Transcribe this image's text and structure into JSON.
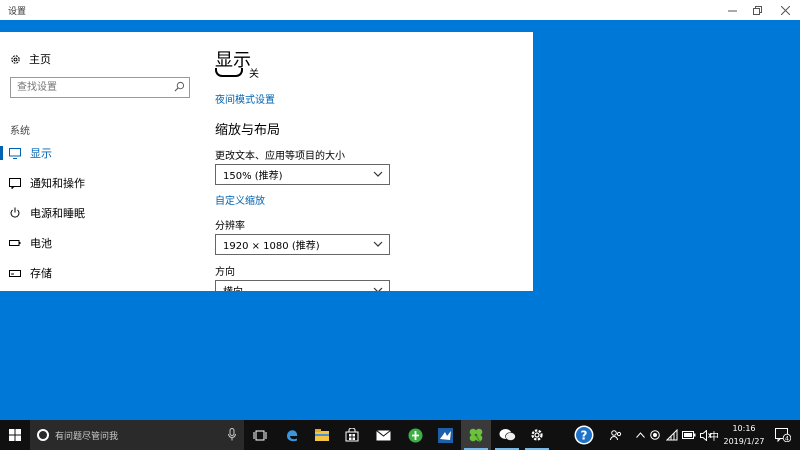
{
  "window": {
    "title": "设置"
  },
  "sidebar": {
    "home_label": "主页",
    "search_placeholder": "查找设置",
    "section_label": "系统",
    "items": [
      {
        "label": "显示",
        "icon": "monitor-icon",
        "active": true
      },
      {
        "label": "通知和操作",
        "icon": "message-icon",
        "active": false
      },
      {
        "label": "电源和睡眠",
        "icon": "power-icon",
        "active": false
      },
      {
        "label": "电池",
        "icon": "battery-icon",
        "active": false
      },
      {
        "label": "存储",
        "icon": "storage-icon",
        "active": false
      }
    ]
  },
  "content": {
    "page_title": "显示",
    "night_light_state": "关",
    "night_light_link": "夜间模式设置",
    "scale_section_title": "缩放与布局",
    "scale_label": "更改文本、应用等项目的大小",
    "scale_value": "150% (推荐)",
    "custom_scale_link": "自定义缩放",
    "resolution_label": "分辨率",
    "resolution_value": "1920 × 1080 (推荐)",
    "orientation_label": "方向",
    "orientation_value": "横向"
  },
  "taskbar": {
    "search_placeholder": "有问题尽管问我",
    "apps": [
      "task-view-icon",
      "edge-icon",
      "file-explorer-icon",
      "store-icon",
      "mail-icon",
      "green-app-icon",
      "bird-app-icon",
      "clover-app-icon",
      "wechat-icon",
      "settings-gear-icon",
      "help-icon"
    ],
    "tray": {
      "ime": "中",
      "time": "10:16",
      "date": "2019/1/27",
      "notification_count": "4"
    }
  },
  "colors": {
    "accent": "#0063b1",
    "desktop": "#0078d7",
    "taskbar": "#101010"
  }
}
